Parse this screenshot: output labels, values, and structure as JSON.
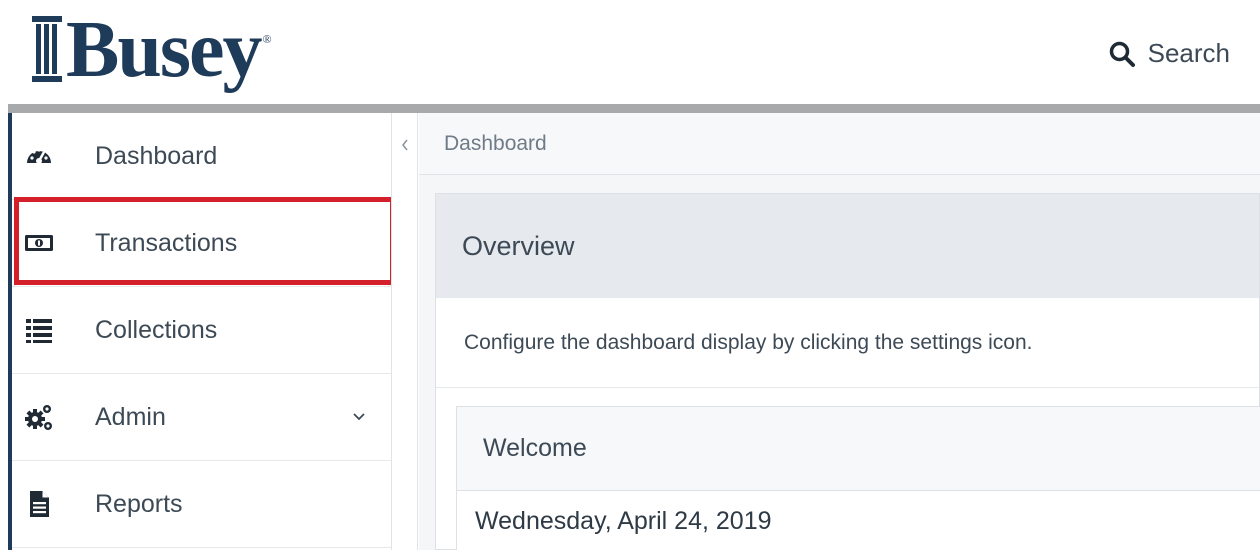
{
  "brand": {
    "logo_text": "Busey",
    "registered_mark": "®",
    "color": "#1f3b5a"
  },
  "header": {
    "search_label": "Search",
    "search_icon": "search-icon"
  },
  "sidebar": {
    "items": [
      {
        "label": "Dashboard",
        "icon": "speedometer-icon"
      },
      {
        "label": "Transactions",
        "icon": "money-bill-icon",
        "highlighted": true
      },
      {
        "label": "Collections",
        "icon": "list-icon"
      },
      {
        "label": "Admin",
        "icon": "gears-icon",
        "has_submenu": true
      },
      {
        "label": "Reports",
        "icon": "document-icon"
      }
    ],
    "collapse_icon": "chevron-left-icon",
    "highlight_color": "#d3202a"
  },
  "main": {
    "breadcrumb": "Dashboard",
    "panel": {
      "title": "Overview",
      "description": "Configure the dashboard display by clicking the settings icon."
    },
    "welcome": {
      "title": "Welcome",
      "date": "Wednesday, April 24, 2019"
    }
  }
}
